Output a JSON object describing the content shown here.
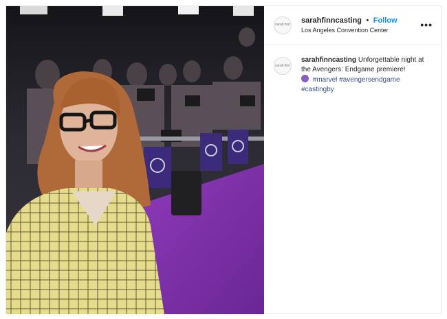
{
  "post": {
    "username": "sarahfinncasting",
    "separator": "•",
    "follow_label": "Follow",
    "location": "Los Angeles Convention Center",
    "more_label": "•••",
    "avatar_text": "sarah finn"
  },
  "caption": {
    "username": "sarahfinncasting",
    "text": "Unforgettable night at the Avengers: Endgame premiere!",
    "emoji_icon": "purple-fist-emoji-icon",
    "hashtags": [
      "#marvel",
      "#avengersendgame",
      "#castingby"
    ]
  },
  "colors": {
    "follow_blue": "#0095f6",
    "carpet_purple": "#7d2fa8",
    "hashtag_blue": "#385185"
  }
}
